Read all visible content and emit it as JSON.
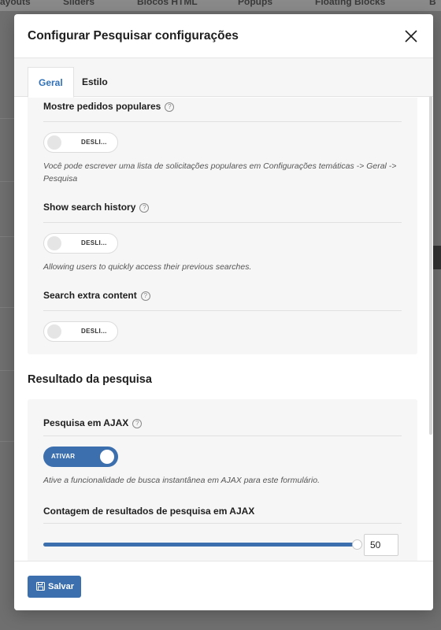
{
  "background": {
    "topbar_items": [
      "ayouts",
      "Sliders",
      "Blocos HTML",
      "Popups",
      "Floating Blocks",
      "B"
    ]
  },
  "modal": {
    "title": "Configurar Pesquisar configurações",
    "close_icon": "close-icon"
  },
  "tabs": [
    {
      "label": "Geral",
      "active": true
    },
    {
      "label": "Estilo",
      "active": false
    }
  ],
  "general_panel": {
    "popular": {
      "label": "Mostre pedidos populares",
      "toggle_text": "DESLI...",
      "toggle_on": false,
      "description": "Você pode escrever uma lista de solicitações populares em Configurações temáticas -> Geral -> Pesquisa"
    },
    "history": {
      "label": "Show search history",
      "toggle_text": "DESLI...",
      "toggle_on": false,
      "description": "Allowing users to quickly access their previous searches."
    },
    "extra": {
      "label": "Search extra content",
      "toggle_text": "DESLI...",
      "toggle_on": false
    }
  },
  "results_section": {
    "title": "Resultado da pesquisa",
    "ajax": {
      "label": "Pesquisa em AJAX",
      "toggle_text": "ATIVAR",
      "toggle_on": true,
      "description": "Ative a funcionalidade de busca instantânea em AJAX para este formulário."
    },
    "count": {
      "label": "Contagem de resultados de pesquisa em AJAX",
      "value": "50",
      "slider_fraction": 1.0
    }
  },
  "footer": {
    "save_label": "Salvar",
    "save_icon": "floppy-disk-icon"
  },
  "colors": {
    "accent": "#3b6fae",
    "tab_active_text": "#3071b9",
    "panel_bg": "#f6f6f6"
  }
}
